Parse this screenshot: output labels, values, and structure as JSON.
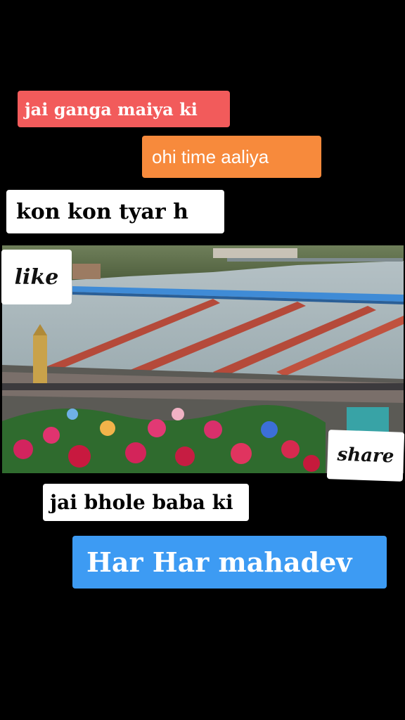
{
  "captions": {
    "line1": "jai ganga maiya ki",
    "line2": "ohi time aaliya",
    "line3": "kon kon tyar h",
    "line4": "jai bhole baba ki",
    "line5": "Har Har mahadev"
  },
  "stickers": {
    "like": "like",
    "share": "share"
  },
  "colors": {
    "background": "#000000",
    "red_tag": "#f25b5b",
    "orange_tag": "#f78a3c",
    "blue_tag": "#3d9bf3",
    "white_tag": "#ffffff"
  }
}
